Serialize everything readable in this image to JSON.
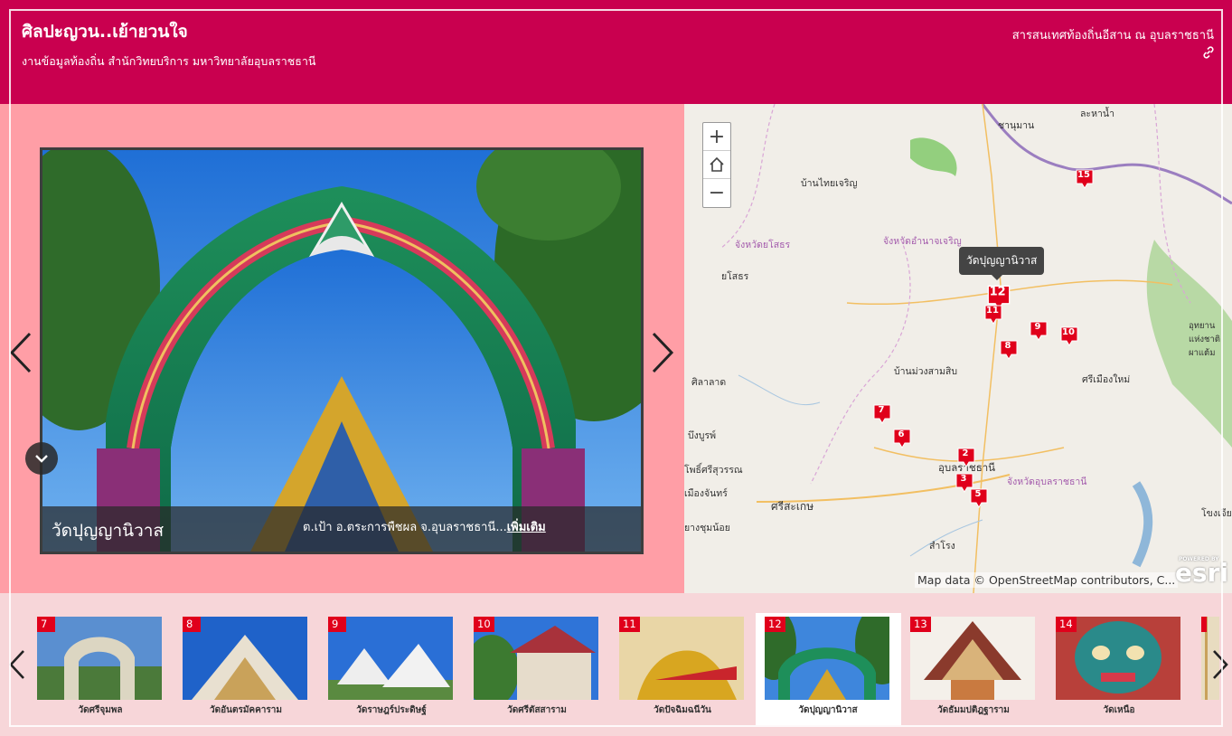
{
  "header": {
    "title": "ศิลปะญวน..เย้ายวนใจ",
    "subtitle": "งานข้อมูลท้องถิ่น สำนักวิทยบริการ มหาวิทยาลัยอุบลราชธานี",
    "byline": "สารสนเทศท้องถิ่นอีสาน ณ อุบลราชธานี",
    "share_icon": "link-icon"
  },
  "viewer": {
    "caption_title": "วัดปุญญานิวาส",
    "caption_desc": "ต.เป้า อ.ตระการพืชผล จ.อุบลราชธานี...",
    "more_label": "เพิ่มเติม"
  },
  "map": {
    "tooltip": "วัดปุญญานิวาส",
    "attribution": "Map data © OpenStreetMap contributors, C...",
    "esri_powered": "POWERED BY",
    "esri_logo": "esri",
    "labels": {
      "l1": "ละหาน้ำ",
      "l2": "ชานุมาน",
      "l3": "บ้านไทยเจริญ",
      "l4": "จังหวัดยโสธร",
      "l5": "จังหวัดอำนาจเจริญ",
      "l6": "ยโสธร",
      "l7": "อุทยาน แห่งชาติ ผาแต้ม",
      "l8": "ศิลาลาด",
      "l9": "บ้านม่วงสามสิบ",
      "l10": "ศรีเมืองใหม่",
      "l11": "บึงบูรพ์",
      "l12": "โพธิ์ศรีสุวรรณ",
      "l13": "อุบลราชธานี",
      "l14": "จังหวัดอุบลราชธานี",
      "l15": "เมืองจันทร์",
      "l16": "ศรีสะเกษ",
      "l17": "ยางชุมน้อย",
      "l18": "สำโรง",
      "l19": "โขงเจียม"
    },
    "markers": [
      "15",
      "12",
      "11",
      "9",
      "10",
      "8",
      "7",
      "6",
      "2",
      "3",
      "5"
    ]
  },
  "strip": {
    "thumbs": [
      {
        "num": "7",
        "label": "วัดศรีจุมพล"
      },
      {
        "num": "8",
        "label": "วัดอันตรมัคคาราม"
      },
      {
        "num": "9",
        "label": "วัดราษฎร์ประดิษฐ์"
      },
      {
        "num": "10",
        "label": "วัดศรีตัสสาราม"
      },
      {
        "num": "11",
        "label": "วัดปัจฉิมฉนีวัน"
      },
      {
        "num": "12",
        "label": "วัดปุญญานิวาส"
      },
      {
        "num": "13",
        "label": "วัดธัมมปติฎฐาราม"
      },
      {
        "num": "14",
        "label": "วัดเหนือ"
      }
    ]
  },
  "colors": {
    "header": "#c9004f",
    "panel": "#ff9ea6",
    "strip": "#f7d6d9",
    "marker": "#e0001b"
  }
}
